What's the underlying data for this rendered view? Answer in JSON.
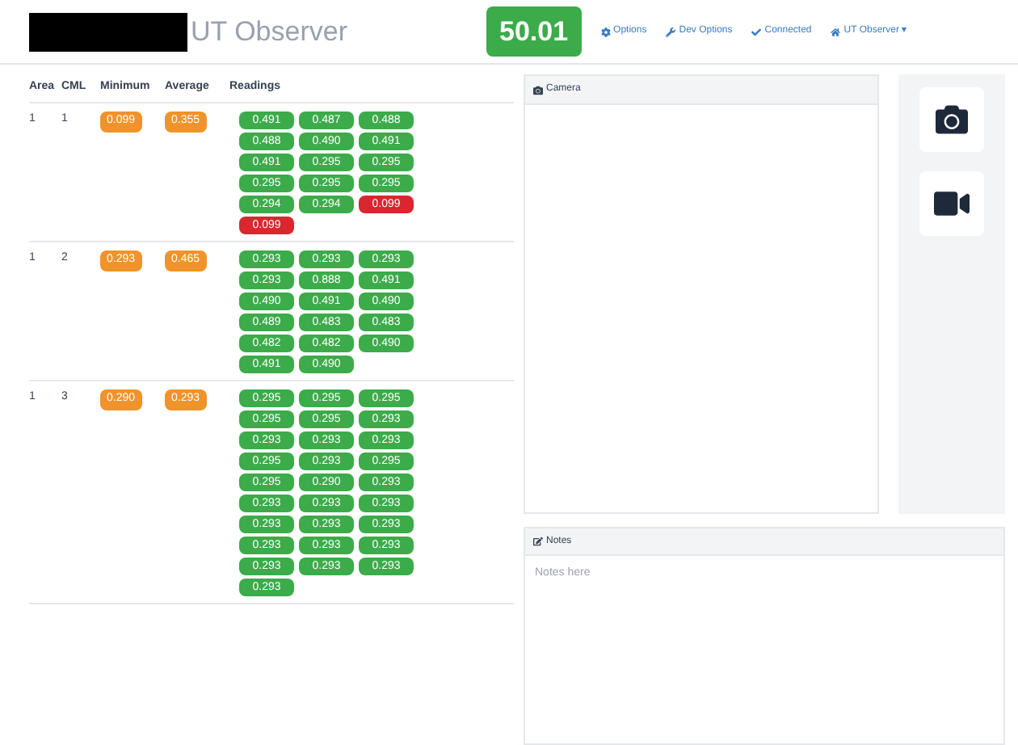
{
  "header": {
    "title": "UT Observer",
    "value": "50.01",
    "nav": [
      {
        "kind": "gear",
        "label": "Options"
      },
      {
        "kind": "wrench",
        "label": "Dev Options"
      },
      {
        "kind": "check",
        "label": "Connected"
      },
      {
        "kind": "home",
        "label": "UT Observer ▾"
      }
    ]
  },
  "table": {
    "columns": [
      "Area",
      "CML",
      "Minimum",
      "Average",
      "Readings"
    ],
    "rows": [
      {
        "area": "1",
        "cml": "1",
        "minimum": "0.099",
        "average": "0.355",
        "readings": [
          {
            "value": "0.491",
            "alarm": false
          },
          {
            "value": "0.487",
            "alarm": false
          },
          {
            "value": "0.488",
            "alarm": false
          },
          {
            "value": "0.488",
            "alarm": false
          },
          {
            "value": "0.490",
            "alarm": false
          },
          {
            "value": "0.491",
            "alarm": false
          },
          {
            "value": "0.491",
            "alarm": false
          },
          {
            "value": "0.295",
            "alarm": false
          },
          {
            "value": "0.295",
            "alarm": false
          },
          {
            "value": "0.295",
            "alarm": false
          },
          {
            "value": "0.295",
            "alarm": false
          },
          {
            "value": "0.295",
            "alarm": false
          },
          {
            "value": "0.294",
            "alarm": false
          },
          {
            "value": "0.294",
            "alarm": false
          },
          {
            "value": "0.099",
            "alarm": true
          },
          {
            "value": "0.099",
            "alarm": true
          }
        ]
      },
      {
        "area": "1",
        "cml": "2",
        "minimum": "0.293",
        "average": "0.465",
        "readings": [
          {
            "value": "0.293",
            "alarm": false
          },
          {
            "value": "0.293",
            "alarm": false
          },
          {
            "value": "0.293",
            "alarm": false
          },
          {
            "value": "0.293",
            "alarm": false
          },
          {
            "value": "0.888",
            "alarm": false
          },
          {
            "value": "0.491",
            "alarm": false
          },
          {
            "value": "0.490",
            "alarm": false
          },
          {
            "value": "0.491",
            "alarm": false
          },
          {
            "value": "0.490",
            "alarm": false
          },
          {
            "value": "0.489",
            "alarm": false
          },
          {
            "value": "0.483",
            "alarm": false
          },
          {
            "value": "0.483",
            "alarm": false
          },
          {
            "value": "0.482",
            "alarm": false
          },
          {
            "value": "0.482",
            "alarm": false
          },
          {
            "value": "0.490",
            "alarm": false
          },
          {
            "value": "0.491",
            "alarm": false
          },
          {
            "value": "0.490",
            "alarm": false
          }
        ]
      },
      {
        "area": "1",
        "cml": "3",
        "minimum": "0.290",
        "average": "0.293",
        "readings": [
          {
            "value": "0.295",
            "alarm": false
          },
          {
            "value": "0.295",
            "alarm": false
          },
          {
            "value": "0.295",
            "alarm": false
          },
          {
            "value": "0.295",
            "alarm": false
          },
          {
            "value": "0.295",
            "alarm": false
          },
          {
            "value": "0.293",
            "alarm": false
          },
          {
            "value": "0.293",
            "alarm": false
          },
          {
            "value": "0.293",
            "alarm": false
          },
          {
            "value": "0.293",
            "alarm": false
          },
          {
            "value": "0.295",
            "alarm": false
          },
          {
            "value": "0.293",
            "alarm": false
          },
          {
            "value": "0.295",
            "alarm": false
          },
          {
            "value": "0.295",
            "alarm": false
          },
          {
            "value": "0.290",
            "alarm": false
          },
          {
            "value": "0.293",
            "alarm": false
          },
          {
            "value": "0.293",
            "alarm": false
          },
          {
            "value": "0.293",
            "alarm": false
          },
          {
            "value": "0.293",
            "alarm": false
          },
          {
            "value": "0.293",
            "alarm": false
          },
          {
            "value": "0.293",
            "alarm": false
          },
          {
            "value": "0.293",
            "alarm": false
          },
          {
            "value": "0.293",
            "alarm": false
          },
          {
            "value": "0.293",
            "alarm": false
          },
          {
            "value": "0.293",
            "alarm": false
          },
          {
            "value": "0.293",
            "alarm": false
          },
          {
            "value": "0.293",
            "alarm": false
          },
          {
            "value": "0.293",
            "alarm": false
          },
          {
            "value": "0.293",
            "alarm": false
          }
        ]
      }
    ]
  },
  "camera": {
    "title": "Camera"
  },
  "notes": {
    "title": "Notes",
    "placeholder": "Notes here"
  }
}
